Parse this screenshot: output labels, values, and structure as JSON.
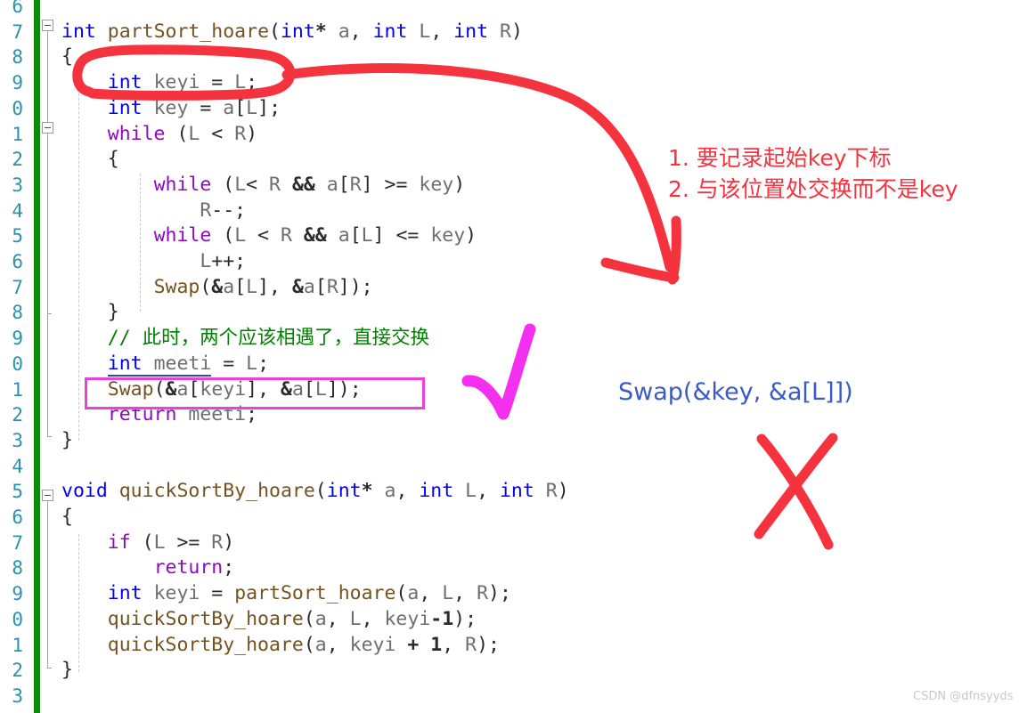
{
  "editor": {
    "name": "visual-studio-code-editor",
    "line_numbers": [
      "6",
      "7",
      "8",
      "9",
      "0",
      "1",
      "2",
      "3",
      "4",
      "5",
      "6",
      "7",
      "8",
      "9",
      "0",
      "1",
      "2",
      "3",
      "4",
      "5",
      "6",
      "7",
      "8",
      "9",
      "0",
      "1",
      "2",
      "3"
    ],
    "lines": [
      {
        "indent": 0,
        "tokens": []
      },
      {
        "indent": 0,
        "tokens": [
          {
            "t": "int",
            "c": "kw"
          },
          {
            "t": " ",
            "c": "pl"
          },
          {
            "t": "partSort_hoare",
            "c": "fn"
          },
          {
            "t": "(",
            "c": "pl"
          },
          {
            "t": "int",
            "c": "kw"
          },
          {
            "t": "*",
            "c": "op"
          },
          {
            "t": " ",
            "c": "pl"
          },
          {
            "t": "a",
            "c": "id"
          },
          {
            "t": ", ",
            "c": "pl"
          },
          {
            "t": "int",
            "c": "kw"
          },
          {
            "t": " ",
            "c": "pl"
          },
          {
            "t": "L",
            "c": "id"
          },
          {
            "t": ", ",
            "c": "pl"
          },
          {
            "t": "int",
            "c": "kw"
          },
          {
            "t": " ",
            "c": "pl"
          },
          {
            "t": "R",
            "c": "id"
          },
          {
            "t": ")",
            "c": "pl"
          }
        ]
      },
      {
        "indent": 0,
        "tokens": [
          {
            "t": "{",
            "c": "pl"
          }
        ]
      },
      {
        "indent": 0,
        "tokens": [
          {
            "t": "    ",
            "c": "pl"
          },
          {
            "t": "int",
            "c": "kw ref"
          },
          {
            "t": " ",
            "c": "pl ref"
          },
          {
            "t": "keyi",
            "c": "id ref"
          },
          {
            "t": " = ",
            "c": "pl"
          },
          {
            "t": "L",
            "c": "id"
          },
          {
            "t": ";",
            "c": "pl"
          }
        ]
      },
      {
        "indent": 0,
        "tokens": [
          {
            "t": "    ",
            "c": "pl"
          },
          {
            "t": "int",
            "c": "kw"
          },
          {
            "t": " ",
            "c": "pl"
          },
          {
            "t": "key",
            "c": "id"
          },
          {
            "t": " = ",
            "c": "pl"
          },
          {
            "t": "a",
            "c": "id"
          },
          {
            "t": "[",
            "c": "pl"
          },
          {
            "t": "L",
            "c": "id"
          },
          {
            "t": "];",
            "c": "pl"
          }
        ]
      },
      {
        "indent": 0,
        "tokens": [
          {
            "t": "    ",
            "c": "pl"
          },
          {
            "t": "while",
            "c": "ctl"
          },
          {
            "t": " (",
            "c": "pl"
          },
          {
            "t": "L",
            "c": "id"
          },
          {
            "t": " < ",
            "c": "pl"
          },
          {
            "t": "R",
            "c": "id"
          },
          {
            "t": ")",
            "c": "pl"
          }
        ]
      },
      {
        "indent": 0,
        "tokens": [
          {
            "t": "    {",
            "c": "pl"
          }
        ]
      },
      {
        "indent": 0,
        "tokens": [
          {
            "t": "        ",
            "c": "pl"
          },
          {
            "t": "while",
            "c": "ctl"
          },
          {
            "t": " (",
            "c": "pl"
          },
          {
            "t": "L",
            "c": "id"
          },
          {
            "t": "< ",
            "c": "pl"
          },
          {
            "t": "R",
            "c": "id"
          },
          {
            "t": " ",
            "c": "pl"
          },
          {
            "t": "&&",
            "c": "op"
          },
          {
            "t": " ",
            "c": "pl"
          },
          {
            "t": "a",
            "c": "id"
          },
          {
            "t": "[",
            "c": "pl"
          },
          {
            "t": "R",
            "c": "id"
          },
          {
            "t": "] >= ",
            "c": "pl"
          },
          {
            "t": "key",
            "c": "id"
          },
          {
            "t": ")",
            "c": "pl"
          }
        ]
      },
      {
        "indent": 0,
        "tokens": [
          {
            "t": "            ",
            "c": "pl"
          },
          {
            "t": "R",
            "c": "id"
          },
          {
            "t": "--;",
            "c": "pl"
          }
        ]
      },
      {
        "indent": 0,
        "tokens": [
          {
            "t": "        ",
            "c": "pl"
          },
          {
            "t": "while",
            "c": "ctl"
          },
          {
            "t": " (",
            "c": "pl"
          },
          {
            "t": "L",
            "c": "id"
          },
          {
            "t": " < ",
            "c": "pl"
          },
          {
            "t": "R",
            "c": "id"
          },
          {
            "t": " ",
            "c": "pl"
          },
          {
            "t": "&&",
            "c": "op"
          },
          {
            "t": " ",
            "c": "pl"
          },
          {
            "t": "a",
            "c": "id"
          },
          {
            "t": "[",
            "c": "pl"
          },
          {
            "t": "L",
            "c": "id"
          },
          {
            "t": "] <= ",
            "c": "pl"
          },
          {
            "t": "key",
            "c": "id"
          },
          {
            "t": ")",
            "c": "pl"
          }
        ]
      },
      {
        "indent": 0,
        "tokens": [
          {
            "t": "            ",
            "c": "pl"
          },
          {
            "t": "L",
            "c": "id"
          },
          {
            "t": "++;",
            "c": "pl"
          }
        ]
      },
      {
        "indent": 0,
        "tokens": [
          {
            "t": "        ",
            "c": "pl"
          },
          {
            "t": "Swap",
            "c": "fn"
          },
          {
            "t": "(",
            "c": "pl"
          },
          {
            "t": "&",
            "c": "op"
          },
          {
            "t": "a",
            "c": "id"
          },
          {
            "t": "[",
            "c": "pl"
          },
          {
            "t": "L",
            "c": "id"
          },
          {
            "t": "], ",
            "c": "pl"
          },
          {
            "t": "&",
            "c": "op"
          },
          {
            "t": "a",
            "c": "id"
          },
          {
            "t": "[",
            "c": "pl"
          },
          {
            "t": "R",
            "c": "id"
          },
          {
            "t": "]);",
            "c": "pl"
          }
        ]
      },
      {
        "indent": 0,
        "tokens": [
          {
            "t": "    }",
            "c": "pl"
          }
        ]
      },
      {
        "indent": 0,
        "tokens": [
          {
            "t": "    // 此时，两个应该相遇了，直接交换",
            "c": "cmt"
          }
        ]
      },
      {
        "indent": 0,
        "tokens": [
          {
            "t": "    ",
            "c": "pl"
          },
          {
            "t": "int",
            "c": "kw ref"
          },
          {
            "t": " ",
            "c": "pl ref"
          },
          {
            "t": "meeti",
            "c": "id ref"
          },
          {
            "t": " = ",
            "c": "pl"
          },
          {
            "t": "L",
            "c": "id"
          },
          {
            "t": ";",
            "c": "pl"
          }
        ]
      },
      {
        "indent": 0,
        "tokens": [
          {
            "t": "    ",
            "c": "pl"
          },
          {
            "t": "Swap",
            "c": "fn"
          },
          {
            "t": "(",
            "c": "pl"
          },
          {
            "t": "&",
            "c": "op"
          },
          {
            "t": "a",
            "c": "id"
          },
          {
            "t": "[",
            "c": "pl"
          },
          {
            "t": "keyi",
            "c": "id"
          },
          {
            "t": "], ",
            "c": "pl"
          },
          {
            "t": "&",
            "c": "op"
          },
          {
            "t": "a",
            "c": "id"
          },
          {
            "t": "[",
            "c": "pl"
          },
          {
            "t": "L",
            "c": "id"
          },
          {
            "t": "]);",
            "c": "pl"
          }
        ]
      },
      {
        "indent": 0,
        "tokens": [
          {
            "t": "    ",
            "c": "pl"
          },
          {
            "t": "return",
            "c": "ctl"
          },
          {
            "t": " ",
            "c": "pl"
          },
          {
            "t": "meeti",
            "c": "id"
          },
          {
            "t": ";",
            "c": "pl"
          }
        ]
      },
      {
        "indent": 0,
        "tokens": [
          {
            "t": "}",
            "c": "pl"
          }
        ]
      },
      {
        "indent": 0,
        "tokens": []
      },
      {
        "indent": 0,
        "tokens": [
          {
            "t": "void",
            "c": "kw"
          },
          {
            "t": " ",
            "c": "pl"
          },
          {
            "t": "quickSortBy_hoare",
            "c": "fn"
          },
          {
            "t": "(",
            "c": "pl"
          },
          {
            "t": "int",
            "c": "kw"
          },
          {
            "t": "*",
            "c": "op"
          },
          {
            "t": " ",
            "c": "pl"
          },
          {
            "t": "a",
            "c": "id"
          },
          {
            "t": ", ",
            "c": "pl"
          },
          {
            "t": "int",
            "c": "kw"
          },
          {
            "t": " ",
            "c": "pl"
          },
          {
            "t": "L",
            "c": "id"
          },
          {
            "t": ", ",
            "c": "pl"
          },
          {
            "t": "int",
            "c": "kw"
          },
          {
            "t": " ",
            "c": "pl"
          },
          {
            "t": "R",
            "c": "id"
          },
          {
            "t": ")",
            "c": "pl"
          }
        ]
      },
      {
        "indent": 0,
        "tokens": [
          {
            "t": "{",
            "c": "pl"
          }
        ]
      },
      {
        "indent": 0,
        "tokens": [
          {
            "t": "    ",
            "c": "pl"
          },
          {
            "t": "if",
            "c": "ctl"
          },
          {
            "t": " (",
            "c": "pl"
          },
          {
            "t": "L",
            "c": "id"
          },
          {
            "t": " >= ",
            "c": "pl"
          },
          {
            "t": "R",
            "c": "id"
          },
          {
            "t": ")",
            "c": "pl"
          }
        ]
      },
      {
        "indent": 0,
        "tokens": [
          {
            "t": "        ",
            "c": "pl"
          },
          {
            "t": "return",
            "c": "ctl"
          },
          {
            "t": ";",
            "c": "pl"
          }
        ]
      },
      {
        "indent": 0,
        "tokens": [
          {
            "t": "    ",
            "c": "pl"
          },
          {
            "t": "int",
            "c": "kw"
          },
          {
            "t": " ",
            "c": "pl"
          },
          {
            "t": "keyi",
            "c": "id"
          },
          {
            "t": " = ",
            "c": "pl"
          },
          {
            "t": "partSort_hoare",
            "c": "fn"
          },
          {
            "t": "(",
            "c": "pl"
          },
          {
            "t": "a",
            "c": "id"
          },
          {
            "t": ", ",
            "c": "pl"
          },
          {
            "t": "L",
            "c": "id"
          },
          {
            "t": ", ",
            "c": "pl"
          },
          {
            "t": "R",
            "c": "id"
          },
          {
            "t": ");",
            "c": "pl"
          }
        ]
      },
      {
        "indent": 0,
        "tokens": [
          {
            "t": "    ",
            "c": "pl"
          },
          {
            "t": "quickSortBy_hoare",
            "c": "fn"
          },
          {
            "t": "(",
            "c": "pl"
          },
          {
            "t": "a",
            "c": "id"
          },
          {
            "t": ", ",
            "c": "pl"
          },
          {
            "t": "L",
            "c": "id"
          },
          {
            "t": ", ",
            "c": "pl"
          },
          {
            "t": "keyi",
            "c": "id"
          },
          {
            "t": "-",
            "c": "op"
          },
          {
            "t": "1",
            "c": "num"
          },
          {
            "t": ");",
            "c": "pl"
          }
        ]
      },
      {
        "indent": 0,
        "tokens": [
          {
            "t": "    ",
            "c": "pl"
          },
          {
            "t": "quickSortBy_hoare",
            "c": "fn"
          },
          {
            "t": "(",
            "c": "pl"
          },
          {
            "t": "a",
            "c": "id"
          },
          {
            "t": ", ",
            "c": "pl"
          },
          {
            "t": "keyi",
            "c": "id"
          },
          {
            "t": " ",
            "c": "pl"
          },
          {
            "t": "+",
            "c": "op"
          },
          {
            "t": " ",
            "c": "pl"
          },
          {
            "t": "1",
            "c": "num"
          },
          {
            "t": ", ",
            "c": "pl"
          },
          {
            "t": "R",
            "c": "id"
          },
          {
            "t": ");",
            "c": "pl"
          }
        ]
      },
      {
        "indent": 0,
        "tokens": [
          {
            "t": "}",
            "c": "pl"
          }
        ]
      },
      {
        "indent": 0,
        "tokens": []
      }
    ]
  },
  "annotations": {
    "red_note_line1": "1. 要记录起始key下标",
    "red_note_line2": "2. 与该位置处交换而不是key",
    "blue_note": "Swap(&key, &a[L]])",
    "red_color": "#f5333f",
    "blue_color": "#3b5bc4",
    "magenta_color": "#ec3fdc"
  },
  "watermark": {
    "text": "CSDN @dfnsyyds"
  }
}
